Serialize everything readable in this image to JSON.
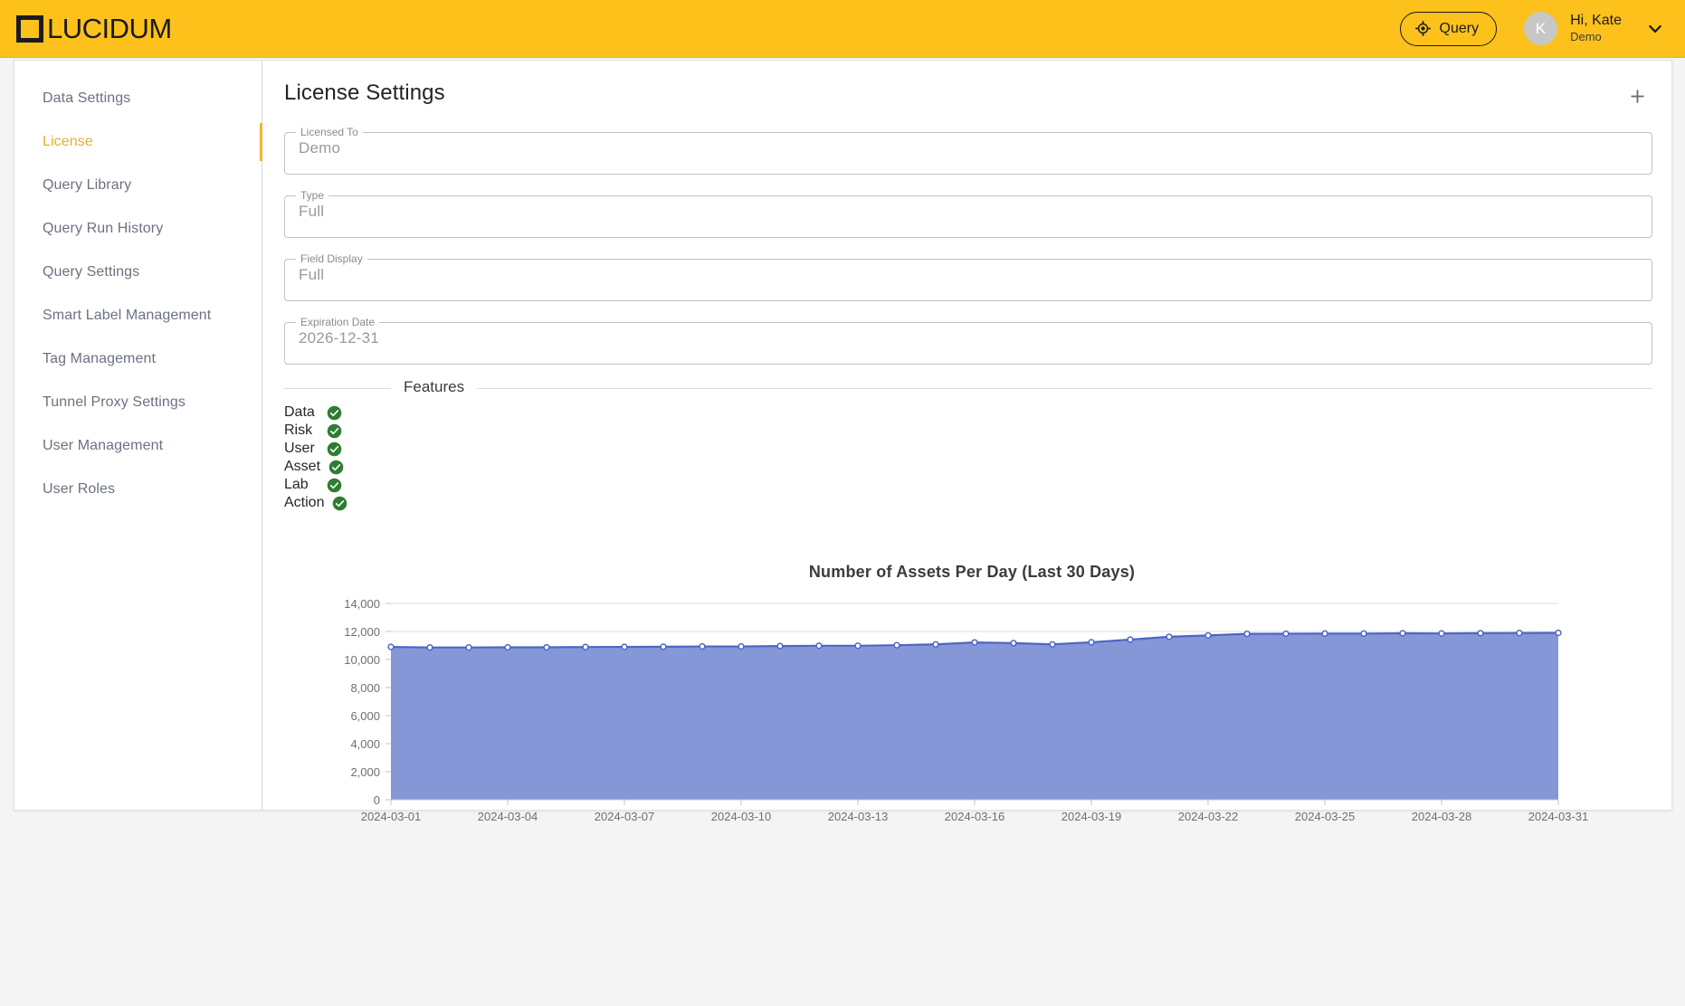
{
  "topbar": {
    "logo_text": "LUCIDUM",
    "query_button": "Query",
    "avatar_initial": "K",
    "user_greeting": "Hi, Kate",
    "user_org": "Demo",
    "brand_color": "#fcc21b"
  },
  "sidebar": {
    "items": [
      {
        "label": "Data Settings",
        "active": false
      },
      {
        "label": "License",
        "active": true
      },
      {
        "label": "Query Library",
        "active": false
      },
      {
        "label": "Query Run History",
        "active": false
      },
      {
        "label": "Query Settings",
        "active": false
      },
      {
        "label": "Smart Label Management",
        "active": false
      },
      {
        "label": "Tag Management",
        "active": false
      },
      {
        "label": "Tunnel Proxy Settings",
        "active": false
      },
      {
        "label": "User Management",
        "active": false
      },
      {
        "label": "User Roles",
        "active": false
      }
    ],
    "active_indicator_color": "#f3b32b"
  },
  "main": {
    "page_title": "License Settings",
    "add_button_label": "+",
    "fields": [
      {
        "label": "Licensed To",
        "value": "Demo"
      },
      {
        "label": "Type",
        "value": "Full"
      },
      {
        "label": "Field Display",
        "value": "Full"
      },
      {
        "label": "Expiration Date",
        "value": "2026-12-31"
      }
    ],
    "features_legend": "Features",
    "features": [
      {
        "label": "Data",
        "enabled": true
      },
      {
        "label": "Risk",
        "enabled": true
      },
      {
        "label": "User",
        "enabled": true
      },
      {
        "label": "Asset",
        "enabled": true
      },
      {
        "label": "Lab",
        "enabled": true
      },
      {
        "label": "Action",
        "enabled": true
      }
    ],
    "feature_check_color": "#2e7d32"
  },
  "chart_data": {
    "type": "area",
    "title": "Number of Assets Per Day (Last 30 Days)",
    "xlabel": "",
    "ylabel": "",
    "ylim": [
      0,
      14000
    ],
    "y_ticks": [
      0,
      2000,
      4000,
      6000,
      8000,
      10000,
      12000,
      14000
    ],
    "y_tick_labels": [
      "0",
      "2,000",
      "4,000",
      "6,000",
      "8,000",
      "10,000",
      "12,000",
      "14,000"
    ],
    "x_tick_labels": [
      "2024-03-01",
      "2024-03-04",
      "2024-03-07",
      "2024-03-10",
      "2024-03-13",
      "2024-03-16",
      "2024-03-19",
      "2024-03-22",
      "2024-03-25",
      "2024-03-28",
      "2024-03-31"
    ],
    "grid": true,
    "legend": "none",
    "line_color": "#4d66c4",
    "area_color": "#8091d6",
    "marker_fill": "#ffffff",
    "x": [
      "2024-03-01",
      "2024-03-02",
      "2024-03-03",
      "2024-03-04",
      "2024-03-05",
      "2024-03-06",
      "2024-03-07",
      "2024-03-08",
      "2024-03-09",
      "2024-03-10",
      "2024-03-11",
      "2024-03-12",
      "2024-03-13",
      "2024-03-14",
      "2024-03-15",
      "2024-03-16",
      "2024-03-17",
      "2024-03-18",
      "2024-03-19",
      "2024-03-20",
      "2024-03-21",
      "2024-03-22",
      "2024-03-23",
      "2024-03-24",
      "2024-03-25",
      "2024-03-26",
      "2024-03-27",
      "2024-03-28",
      "2024-03-29",
      "2024-03-30",
      "2024-03-31"
    ],
    "series": [
      {
        "name": "Assets",
        "values": [
          10900,
          10860,
          10860,
          10870,
          10870,
          10890,
          10900,
          10910,
          10930,
          10930,
          10960,
          10980,
          10980,
          11020,
          11080,
          11220,
          11170,
          11080,
          11230,
          11420,
          11620,
          11720,
          11830,
          11840,
          11850,
          11850,
          11870,
          11860,
          11880,
          11890,
          11900
        ]
      }
    ]
  }
}
